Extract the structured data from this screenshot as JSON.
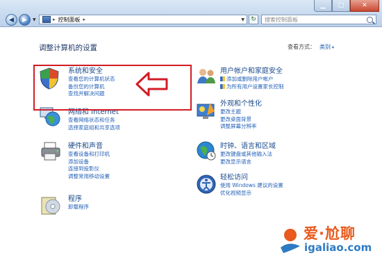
{
  "address_bar": {
    "breadcrumb": [
      "控制面板"
    ],
    "search_placeholder": "搜索控制面板"
  },
  "heading": "调整计算机的设置",
  "view_by": {
    "label": "查看方式：",
    "value": "类别"
  },
  "categories": [
    {
      "title": "系统和安全",
      "links": [
        "查看您的计算机状态",
        "备份您的计算机",
        "查找并解决问题"
      ]
    },
    {
      "title": "网络和 Internet",
      "links": [
        "查看网络状态和任务",
        "选择家庭组和共享选项"
      ]
    },
    {
      "title": "硬件和声音",
      "links": [
        "查看设备和打印机",
        "添加设备",
        "连接到投影仪",
        "调整常用移动设置"
      ]
    },
    {
      "title": "程序",
      "links": [
        "卸载程序"
      ]
    },
    {
      "title": "用户帐户和家庭安全",
      "links": [
        "添加或删除用户帐户",
        "为所有用户设置家长控制"
      ]
    },
    {
      "title": "外观和个性化",
      "links": [
        "更改主题",
        "更改桌面背景",
        "调整屏幕分辨率"
      ]
    },
    {
      "title": "时钟、语言和区域",
      "links": [
        "更改键盘或其他输入法",
        "更改显示语言"
      ]
    },
    {
      "title": "轻松访问",
      "links": [
        "使用 Windows 建议的设置",
        "优化视频显示"
      ]
    }
  ],
  "watermark": {
    "title": "爱·尬聊",
    "url": "igaliao.com"
  },
  "colors": {
    "highlight_box": "#d31c24",
    "link": "#2461b6",
    "title": "#1a4a8c",
    "watermark_orange": "#e85a1d",
    "watermark_blue": "#2e7bc4"
  },
  "icons": [
    "back-icon",
    "forward-icon",
    "control-panel-icon",
    "refresh-icon",
    "search-icon",
    "shield-icon",
    "network-globe-icon",
    "printer-icon",
    "programs-disc-icon",
    "users-icon",
    "appearance-icon",
    "clock-globe-icon",
    "accessibility-icon",
    "red-arrow-icon"
  ]
}
